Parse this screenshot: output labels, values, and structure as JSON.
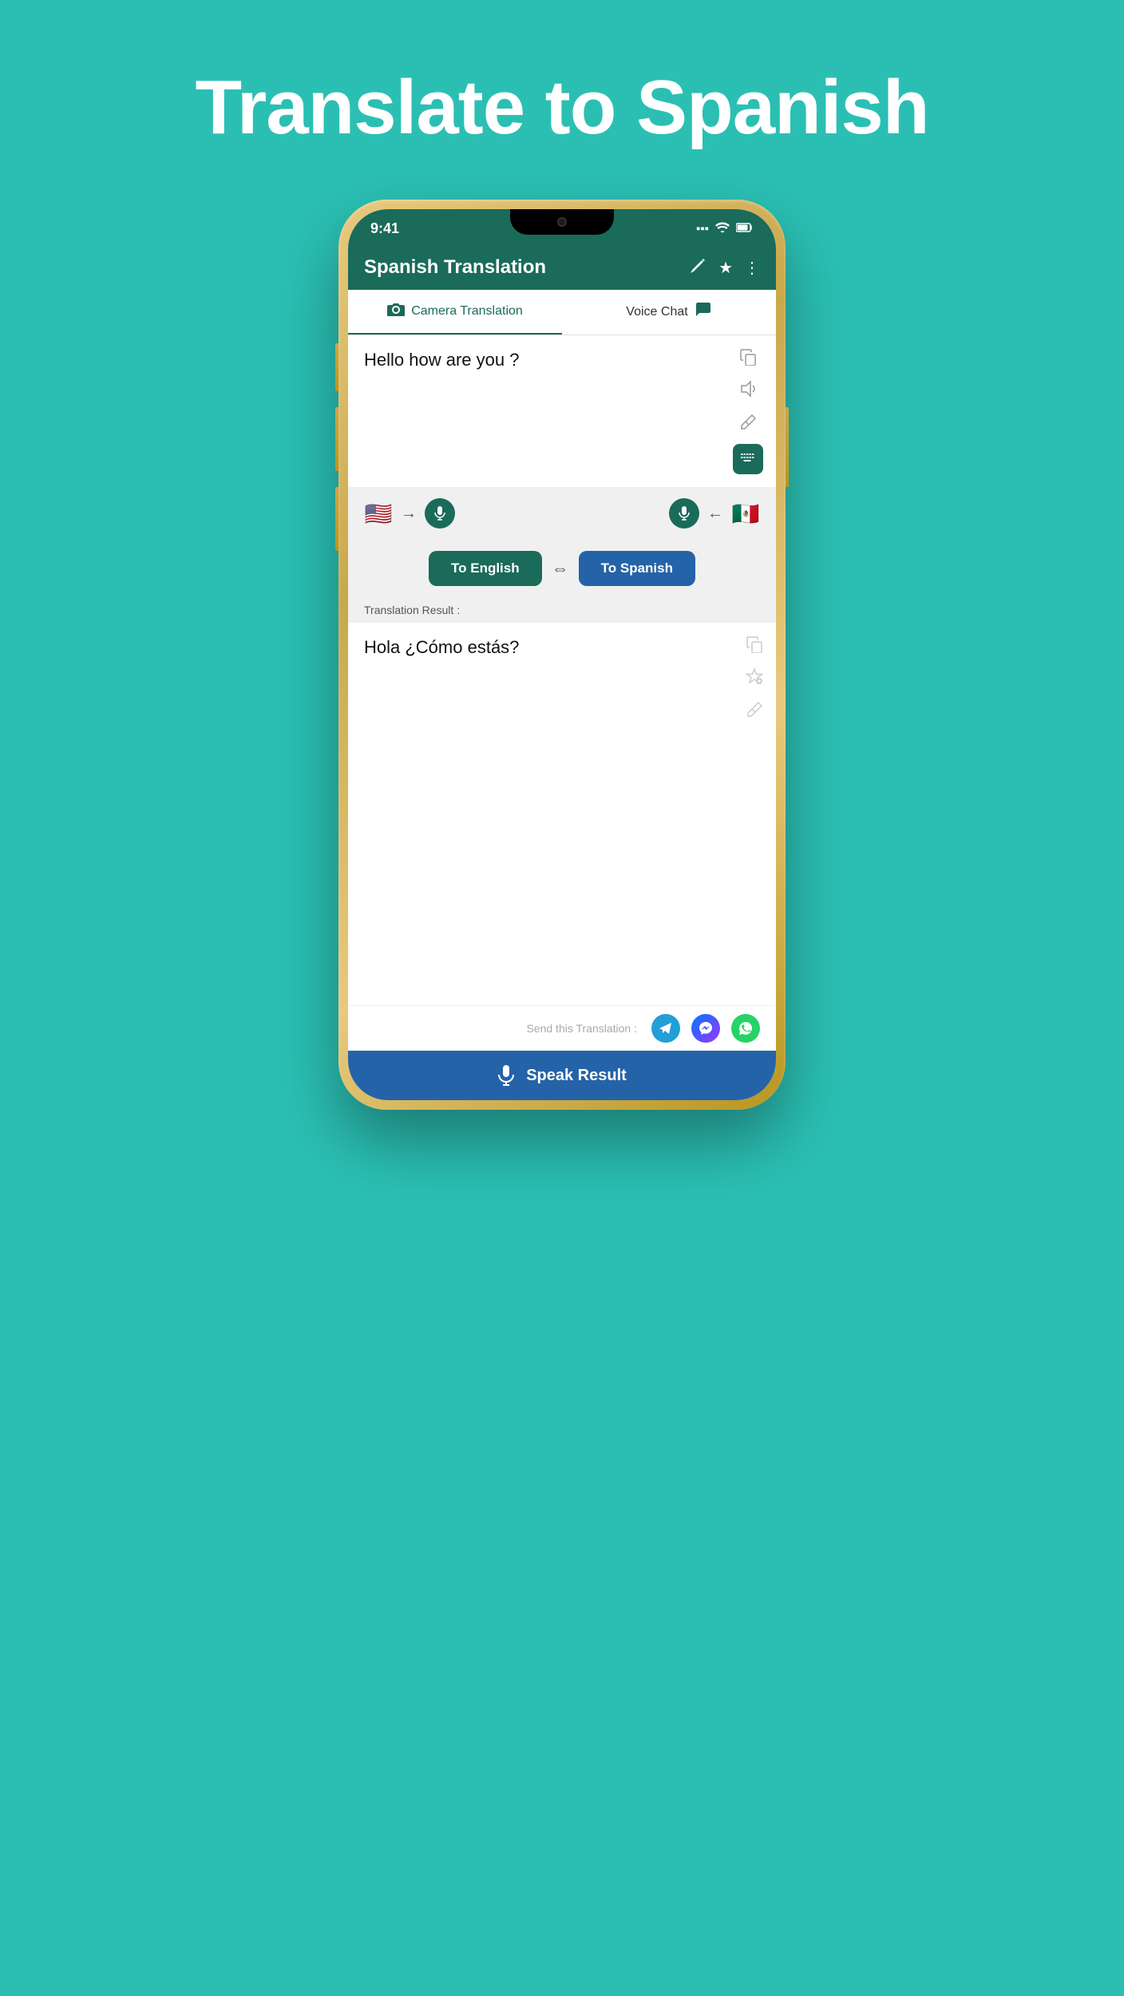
{
  "page": {
    "title": "Translate to Spanish",
    "background": "#2bbfb3"
  },
  "phone": {
    "status_bar": {
      "time": "9:41",
      "signal": "●●●",
      "wifi": "wifi",
      "battery": "battery"
    },
    "header": {
      "title": "Spanish Translation",
      "edit_icon": "✏️",
      "star_icon": "★",
      "more_icon": "⋮"
    },
    "tabs": [
      {
        "label": "Camera Translation",
        "icon": "📷",
        "active": true
      },
      {
        "label": "Voice Chat",
        "icon": "💬",
        "active": false
      }
    ],
    "input": {
      "text": "Hello how are you ?",
      "copy_label": "copy",
      "speaker_label": "speaker",
      "eraser_label": "eraser",
      "keyboard_label": "keyboard"
    },
    "language_bar": {
      "source_flag": "🇺🇸",
      "source_arrow": "→",
      "source_mic": "🎤",
      "target_mic": "🎤",
      "target_arrow": "←",
      "target_flag": "🇲🇽"
    },
    "translate_buttons": {
      "to_english": "To English",
      "swap": "⇔",
      "to_spanish": "To Spanish"
    },
    "result": {
      "label": "Translation Result :",
      "text": "Hola ¿Cómo estás?",
      "copy_label": "copy",
      "star_label": "star",
      "eraser_label": "eraser"
    },
    "send": {
      "label": "Send this Translation :",
      "telegram_label": "telegram",
      "messenger_label": "messenger",
      "whatsapp_label": "whatsapp"
    },
    "speak_button": "Speak Result"
  }
}
